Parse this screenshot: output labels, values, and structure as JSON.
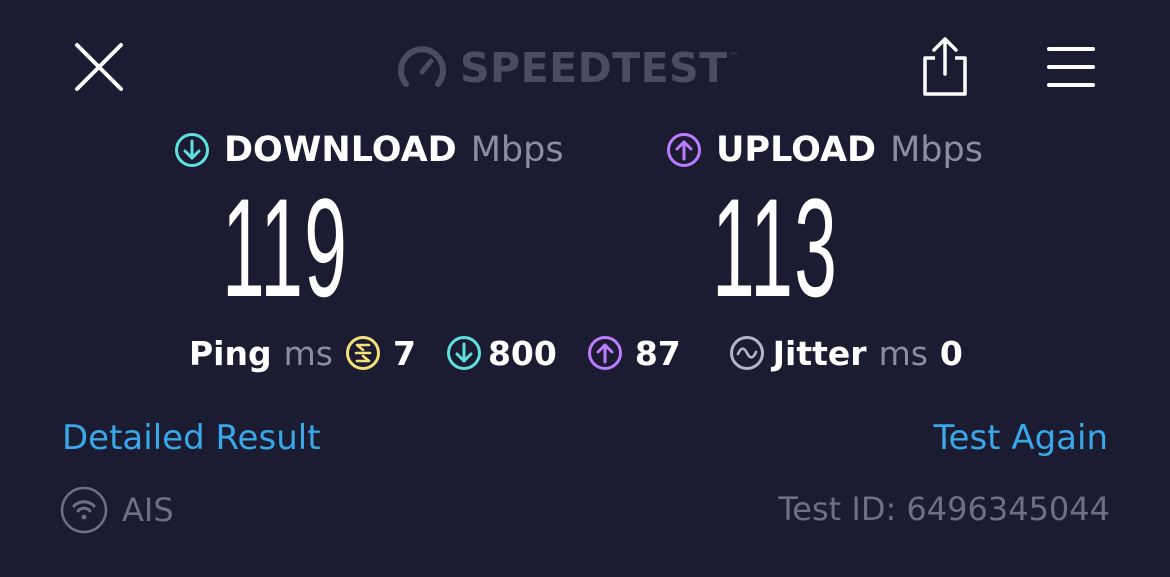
{
  "header": {
    "close_icon": "close-icon",
    "brand": "SPEEDTEST",
    "brand_mark": "™",
    "share_icon": "share-icon",
    "menu_icon": "hamburger-menu-icon"
  },
  "download": {
    "label": "DOWNLOAD",
    "unit": "Mbps",
    "value": "119",
    "icon": "download-arrow-icon",
    "color": "#5fe0e0"
  },
  "upload": {
    "label": "UPLOAD",
    "unit": "Mbps",
    "value": "113",
    "icon": "upload-arrow-icon",
    "color": "#bc7cff"
  },
  "ping": {
    "label": "Ping",
    "unit": "ms",
    "idle_value": "7",
    "idle_color": "#f5e17a",
    "download_value": "800",
    "upload_value": "87"
  },
  "jitter": {
    "label": "Jitter",
    "unit": "ms",
    "value": "0"
  },
  "links": {
    "detailed": "Detailed Result",
    "again": "Test Again",
    "color": "#3aa7e8"
  },
  "footer": {
    "provider": "AIS",
    "provider_icon": "wifi-icon",
    "test_id": "Test ID: 6496345044"
  }
}
